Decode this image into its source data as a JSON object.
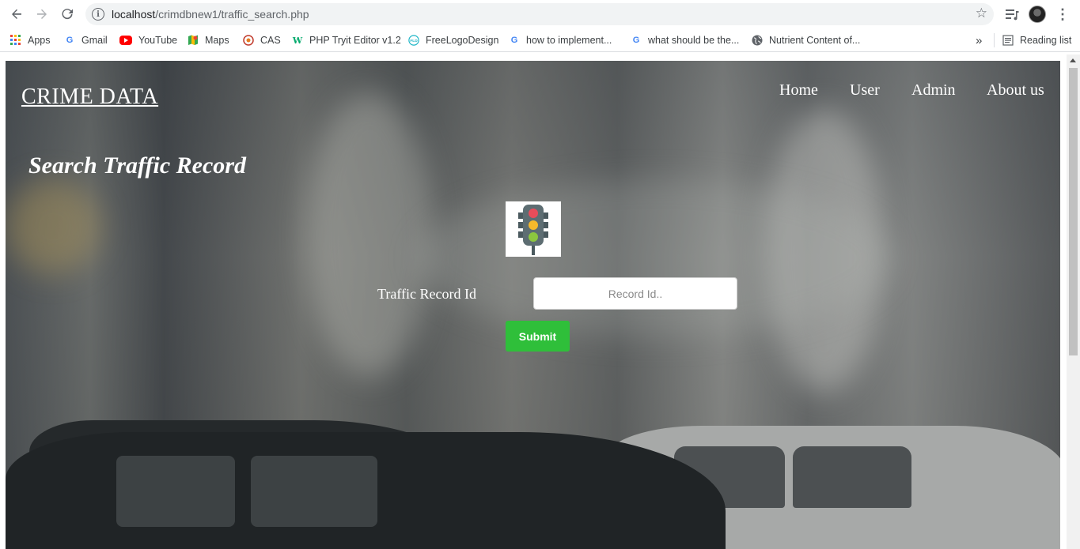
{
  "browser": {
    "url_host": "localhost",
    "url_path": "/crimdbnew1/traffic_search.php",
    "bookmarks": [
      {
        "label": "Apps",
        "icon": "apps-grid-icon"
      },
      {
        "label": "Gmail",
        "icon": "google-icon"
      },
      {
        "label": "YouTube",
        "icon": "youtube-icon"
      },
      {
        "label": "Maps",
        "icon": "maps-icon"
      },
      {
        "label": "CAS",
        "icon": "cas-icon"
      },
      {
        "label": "PHP Tryit Editor v1.2",
        "icon": "w3schools-icon"
      },
      {
        "label": "FreeLogoDesign",
        "icon": "freelogodesign-icon"
      },
      {
        "label": "how to implement...",
        "icon": "google-icon"
      },
      {
        "label": "what should be the...",
        "icon": "google-icon"
      },
      {
        "label": "Nutrient Content of...",
        "icon": "globe-icon"
      }
    ],
    "overflow": "»",
    "reading_list": "Reading list"
  },
  "site": {
    "brand": "CRIME DATA",
    "nav": [
      "Home",
      "User",
      "Admin",
      "About us"
    ]
  },
  "main": {
    "title": "Search Traffic Record",
    "icon": "traffic-light-icon",
    "field_label": "Traffic Record Id",
    "field_placeholder": "Record Id..",
    "field_value": "",
    "submit_label": "Submit"
  },
  "colors": {
    "submit": "#2fbf3a",
    "traffic_light_red": "#e84c5a",
    "traffic_light_yellow": "#f6b92b",
    "traffic_light_green": "#8cc63f"
  }
}
